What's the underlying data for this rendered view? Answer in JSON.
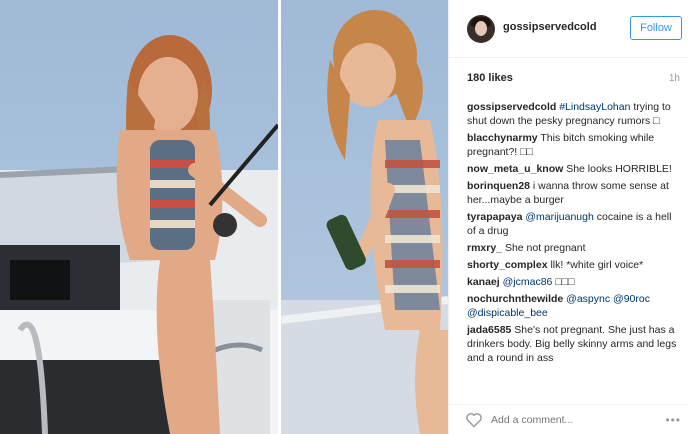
{
  "post": {
    "username": "gossipservedcold",
    "follow_label": "Follow",
    "likes": "180 likes",
    "time": "1h"
  },
  "comments": [
    {
      "user": "gossipservedcold",
      "segments": [
        {
          "type": "hashtag",
          "text": " #LindsayLohan"
        },
        {
          "type": "text",
          "text": " trying to shut down the pesky pregnancy rumors □"
        }
      ]
    },
    {
      "user": "blacchynarmy",
      "segments": [
        {
          "type": "text",
          "text": " This bitch smoking while pregnant?! □□"
        }
      ]
    },
    {
      "user": "now_meta_u_know",
      "segments": [
        {
          "type": "text",
          "text": " She looks HORRIBLE!"
        }
      ]
    },
    {
      "user": "borinquen28",
      "segments": [
        {
          "type": "text",
          "text": " i wanna throw some sense at her...maybe a burger"
        }
      ]
    },
    {
      "user": "tyrapapaya",
      "segments": [
        {
          "type": "mention",
          "text": " @marijuanugh"
        },
        {
          "type": "text",
          "text": " cocaine is a hell of a drug"
        }
      ]
    },
    {
      "user": "rmxry_",
      "segments": [
        {
          "type": "text",
          "text": " She not pregnant"
        }
      ]
    },
    {
      "user": "shorty_complex",
      "segments": [
        {
          "type": "text",
          "text": " llk! *white girl voice*"
        }
      ]
    },
    {
      "user": "kanaej",
      "segments": [
        {
          "type": "mention",
          "text": " @jcmac86"
        },
        {
          "type": "text",
          "text": " □□□"
        }
      ]
    },
    {
      "user": "nochurchnthewilde",
      "segments": [
        {
          "type": "mention",
          "text": " @aspync"
        },
        {
          "type": "text",
          "text": " "
        },
        {
          "type": "mention",
          "text": "@90roc"
        },
        {
          "type": "text",
          "text": " "
        },
        {
          "type": "mention",
          "text": "@dispicable_bee"
        }
      ]
    },
    {
      "user": "jada6585",
      "segments": [
        {
          "type": "text",
          "text": " She's not pregnant. She just has a drinkers body. Big belly skinny arms and legs and a round in ass"
        }
      ]
    }
  ],
  "footer": {
    "add_comment_placeholder": "Add a comment...",
    "more": "•••"
  },
  "colors": {
    "follow_blue": "#3897f0",
    "mention_blue": "#003569",
    "sky": "#a9c1dc"
  }
}
